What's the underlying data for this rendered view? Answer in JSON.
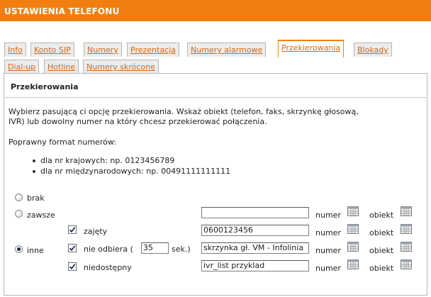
{
  "header": {
    "title": "USTAWIENIA TELEFONU"
  },
  "tabs": [
    {
      "label": "Info"
    },
    {
      "label": "Konto SIP"
    },
    {
      "label": "Numery"
    },
    {
      "label": "Prezentacja"
    },
    {
      "label": "Numery alarmowe"
    },
    {
      "label": "Przekierowania",
      "active": true
    },
    {
      "label": "Blokady"
    },
    {
      "label": "Dial-up"
    },
    {
      "label": "Hotline"
    },
    {
      "label": "Numery skrócone"
    }
  ],
  "panel": {
    "title": "Przekierowania",
    "description_line1": "Wybierz pasującą ci opcję przekierowania. Wskaż obiekt (telefon, faks, skrzynkę głosową,",
    "description_line2": "IVR) lub dowolny numer na który chcesz przekierować połączenia.",
    "format_heading": "Poprawny format numerów:",
    "format_items": [
      "dla nr krajowych: np. 0123456789",
      "dla nr międzynarodowych: np. 00491111111111"
    ]
  },
  "options": {
    "brak": {
      "label": "brak",
      "checked": false
    },
    "zawsze": {
      "label": "zawsze",
      "checked": false,
      "value": ""
    },
    "inne": {
      "label": "inne",
      "checked": true
    }
  },
  "conditions": [
    {
      "label": "zajęty",
      "checked": true,
      "value": "0600123456"
    },
    {
      "label": "nie odbiera (",
      "checked": true,
      "seconds": "35",
      "seconds_suffix": "sek.)",
      "value": "skrzynka gł. VM - Infolinia"
    },
    {
      "label": "niedostępny",
      "checked": true,
      "value": "ivr_list przyklad"
    }
  ],
  "target_labels": {
    "numer": "numer",
    "obiekt": "obiekt"
  }
}
